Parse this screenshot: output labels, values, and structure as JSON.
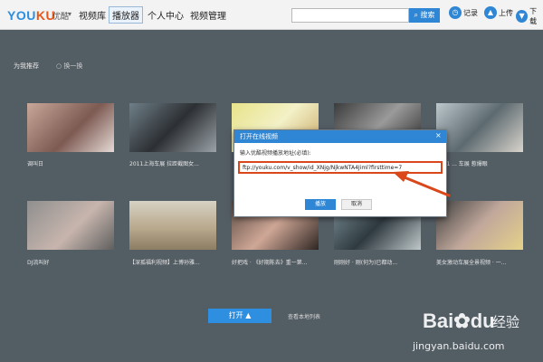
{
  "app": {
    "logo_a": "YOU",
    "logo_b": "KU",
    "logo_sub": "优酷",
    "nav": [
      "视频库",
      "播放器",
      "个人中心",
      "视频管理"
    ],
    "active_tab": "播放器",
    "search_button": "搜索",
    "tools": [
      {
        "label": "记录",
        "icon": "clock-icon"
      },
      {
        "label": "上传",
        "icon": "upload-icon"
      },
      {
        "label": "下载",
        "icon": "download-icon"
      }
    ]
  },
  "section": {
    "title": "为我推荐",
    "swap": "换一换"
  },
  "videos": [
    {
      "caption": "调叫日"
    },
    {
      "caption": "2011上海车展 拉距截图女..."
    },
    {
      "caption": ""
    },
    {
      "caption": ""
    },
    {
      "caption": "2011 ... 车展 惹爆眼"
    },
    {
      "caption": "DJ流叫好"
    },
    {
      "caption": "【深孤福利视频】上博孙雅..."
    },
    {
      "caption": "好把戏 · 《好期陈去》重一第..."
    },
    {
      "caption": "刚刚好 · 刚(何为)已都动..."
    },
    {
      "caption": "美女激动车展全景视频 · 一..."
    }
  ],
  "dialog": {
    "title": "打开在线视频",
    "label": "输入优酷视频播放地址(必填):",
    "url": "ftp://youku.com/v_show/id_XNjg/NjkwNTA4Jiml?firsttime=7",
    "play_button": "播放",
    "cancel_button": "取消",
    "close_glyph": "×"
  },
  "footer": {
    "open_button": "打开",
    "recent_link": "查看本地列表"
  },
  "watermark": {
    "brand_a": "Bai",
    "brand_b": "du",
    "brand_c": "经验",
    "url": "jingyan.baidu.com"
  },
  "colors": {
    "accent": "#2f86d4",
    "highlight": "#d9471a",
    "background": "#535d64"
  }
}
